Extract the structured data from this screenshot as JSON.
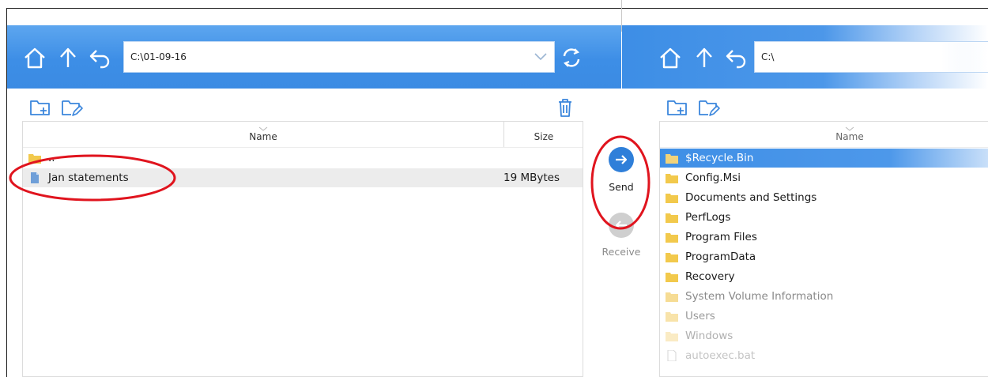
{
  "left_panel": {
    "path": "C:\\01-09-16",
    "columns": {
      "name": "Name",
      "size": "Size"
    },
    "rows": [
      {
        "name": "..",
        "size": "",
        "type": "folder"
      },
      {
        "name": "Jan statements",
        "size": "19 MBytes",
        "type": "file"
      }
    ]
  },
  "transfer": {
    "send_label": "Send",
    "receive_label": "Receive"
  },
  "right_panel": {
    "path": "C:\\",
    "columns": {
      "name": "Name"
    },
    "rows": [
      {
        "name": "$Recycle.Bin",
        "type": "folder"
      },
      {
        "name": "Config.Msi",
        "type": "folder"
      },
      {
        "name": "Documents and Settings",
        "type": "folder"
      },
      {
        "name": "PerfLogs",
        "type": "folder"
      },
      {
        "name": "Program Files",
        "type": "folder"
      },
      {
        "name": "ProgramData",
        "type": "folder"
      },
      {
        "name": "Recovery",
        "type": "folder"
      },
      {
        "name": "System Volume Information",
        "type": "folder"
      },
      {
        "name": "Users",
        "type": "folder"
      },
      {
        "name": "Windows",
        "type": "folder"
      },
      {
        "name": "autoexec.bat",
        "type": "file"
      }
    ]
  },
  "colors": {
    "toolbar_blue": "#3d8ee6",
    "send_button": "#2f7fd9",
    "receive_button_disabled": "#c9c9c9",
    "annotation_red": "#e0141e",
    "folder_yellow": "#f2c94c"
  },
  "icons": {
    "toolbar": [
      "home-icon",
      "up-arrow-icon",
      "back-arrow-icon",
      "refresh-icon",
      "chevron-down-icon"
    ],
    "actions": [
      "new-folder-icon",
      "rename-folder-icon",
      "trash-icon"
    ],
    "transfer": [
      "arrow-right-icon",
      "arrow-left-icon"
    ]
  }
}
